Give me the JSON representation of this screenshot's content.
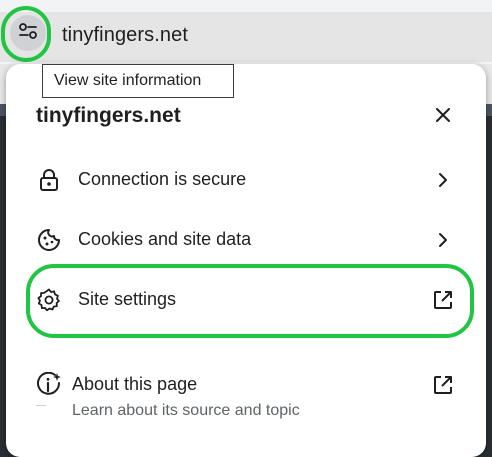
{
  "omnibox": {
    "url": "tinyfingers.net",
    "site_info_icon": "tune-icon"
  },
  "tooltip": {
    "text": "View site information"
  },
  "popup": {
    "title": "tinyfingers.net",
    "close_icon": "close-icon",
    "items": [
      {
        "label": "Connection is secure",
        "icon": "lock-icon",
        "trailing": "chevron-right-icon"
      },
      {
        "label": "Cookies and site data",
        "icon": "cookie-icon",
        "trailing": "chevron-right-icon"
      },
      {
        "label": "Site settings",
        "icon": "gear-icon",
        "trailing": "open-external-icon"
      }
    ],
    "about": {
      "label": "About this page",
      "sublabel": "Learn about its source and topic",
      "icon": "info-sparkle-icon",
      "trailing": "open-external-icon"
    }
  },
  "colors": {
    "highlight": "#22c443",
    "popup_bg": "#ffffff",
    "omnibox_bg": "#e5e5e5"
  }
}
